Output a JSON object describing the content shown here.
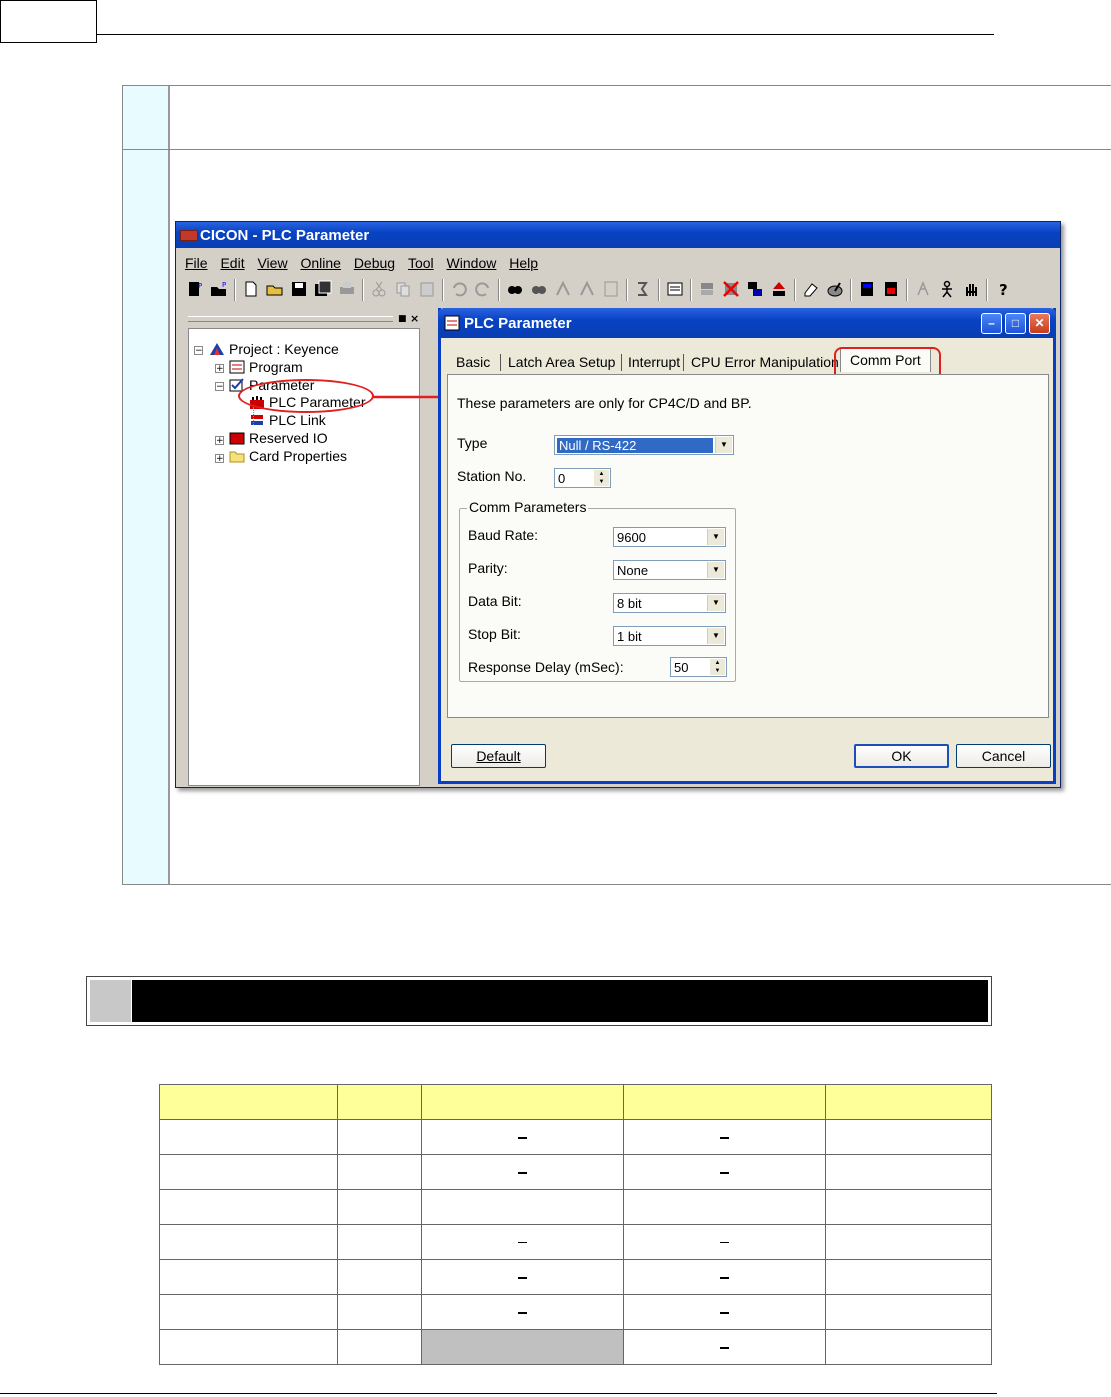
{
  "window": {
    "title": "CICON - PLC Parameter",
    "menu": [
      "File",
      "Edit",
      "View",
      "Online",
      "Debug",
      "Tool",
      "Window",
      "Help"
    ]
  },
  "tree": {
    "project": "Project : Keyence",
    "items": [
      "Program",
      "Parameter",
      "PLC Parameter",
      "PLC Link",
      "Reserved IO",
      "Card Properties"
    ]
  },
  "dialog": {
    "title": "PLC Parameter",
    "tabs": [
      "Basic",
      "Latch Area Setup",
      "Interrupt",
      "CPU Error Manipulation",
      "Comm Port"
    ],
    "active_tab": "Comm Port",
    "note": "These parameters are only for CP4C/D and BP.",
    "type_label": "Type",
    "type_value": "Null / RS-422",
    "station_label": "Station No.",
    "station_value": "0",
    "group_title": "Comm Parameters",
    "baud_label": "Baud Rate:",
    "baud_value": "9600",
    "parity_label": "Parity:",
    "parity_value": "None",
    "databit_label": "Data Bit:",
    "databit_value": "8 bit",
    "stopbit_label": "Stop Bit:",
    "stopbit_value": "1 bit",
    "delay_label": "Response Delay (mSec):",
    "delay_value": "50",
    "default_button": "Default",
    "ok_button": "OK",
    "cancel_button": "Cancel"
  },
  "spec_table": {
    "columns": 5,
    "rows": 7
  }
}
